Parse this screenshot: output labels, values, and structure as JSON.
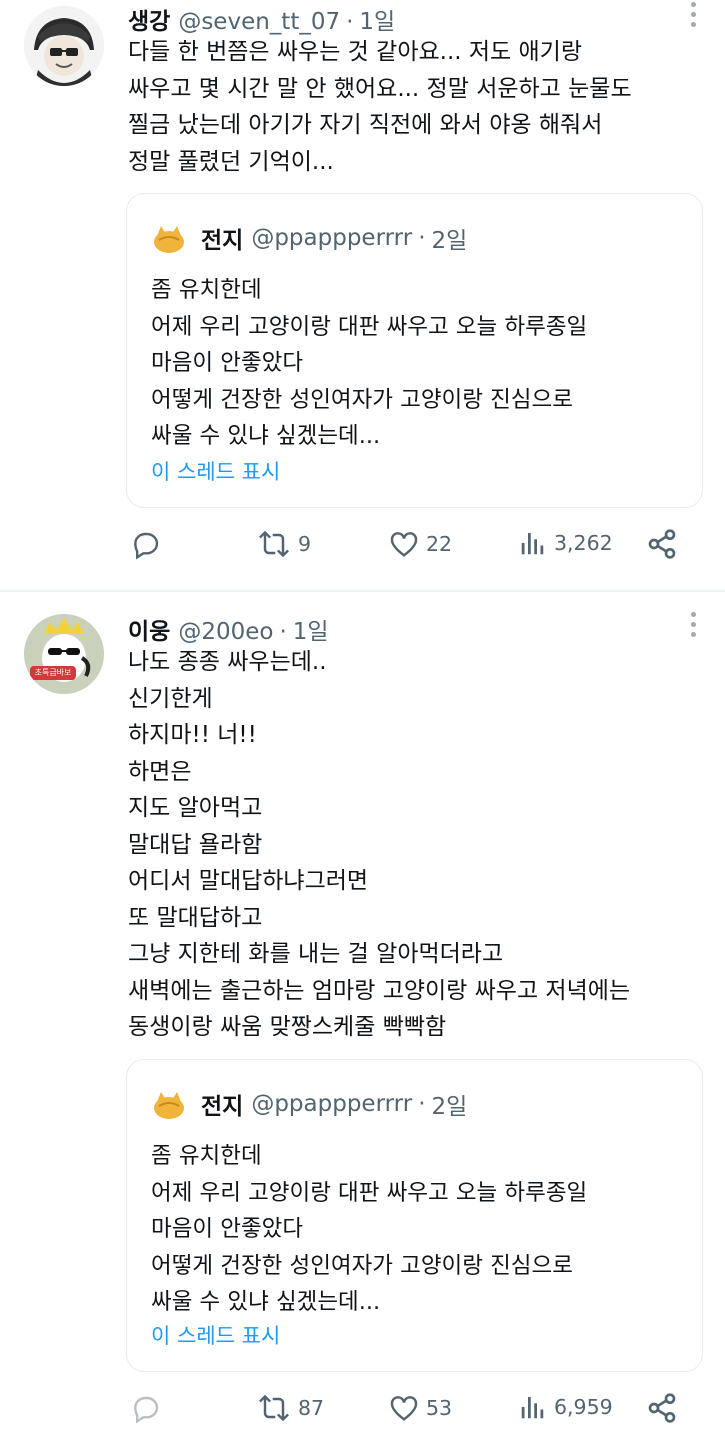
{
  "tweets": [
    {
      "name": "생강",
      "handle": "@seven_tt_07",
      "time": "1일",
      "lines": [
        "다들 한 번쯤은 싸우는 것 같아요... 저도 애기랑",
        "싸우고 몇 시간 말 안 했어요... 정말 서운하고 눈물도",
        "찔금 났는데 아기가 자기 직전에 와서 야옹 해줘서",
        "정말 풀렸던 기억이..."
      ],
      "quote": {
        "name": "전지",
        "handle": "@ppappperrrr",
        "time": "2일",
        "lines": [
          "좀 유치한데",
          "어제 우리 고양이랑 대판 싸우고 오늘 하루종일",
          "마음이 안좋았다",
          "어떻게 건장한 성인여자가 고양이랑 진심으로",
          "싸울 수 있냐 싶겠는데..."
        ],
        "link": "이 스레드 표시"
      },
      "stats": {
        "replies": "",
        "retweets": "9",
        "likes": "22",
        "views": "3,262"
      }
    },
    {
      "name": "이웅",
      "handle": "@200eo",
      "time": "1일",
      "avatar_badge": "초특급바보",
      "lines": [
        "나도 종종 싸우는데..",
        "신기한게",
        "하지마!! 너!!",
        "하면은",
        "지도 알아먹고",
        "말대답 욜라함",
        "어디서 말대답하냐그러면",
        "또 말대답하고",
        "그냥 지한테 화를 내는 걸 알아먹더라고",
        "새벽에는 출근하는 엄마랑 고양이랑 싸우고 저녁에는",
        "동생이랑 싸움 맞짱스케줄 빡빡함"
      ],
      "quote": {
        "name": "전지",
        "handle": "@ppappperrrr",
        "time": "2일",
        "lines": [
          "좀 유치한데",
          "어제 우리 고양이랑 대판 싸우고 오늘 하루종일",
          "마음이 안좋았다",
          "어떻게 건장한 성인여자가 고양이랑 진심으로",
          "싸울 수 있냐 싶겠는데..."
        ],
        "link": "이 스레드 표시"
      },
      "stats": {
        "replies": "",
        "retweets": "87",
        "likes": "53",
        "views": "6,959"
      }
    }
  ],
  "separator": "·",
  "colors": {
    "text": "#0f1419",
    "secondary": "#536471",
    "link": "#1d9bf0",
    "border": "#e6ecf0"
  }
}
